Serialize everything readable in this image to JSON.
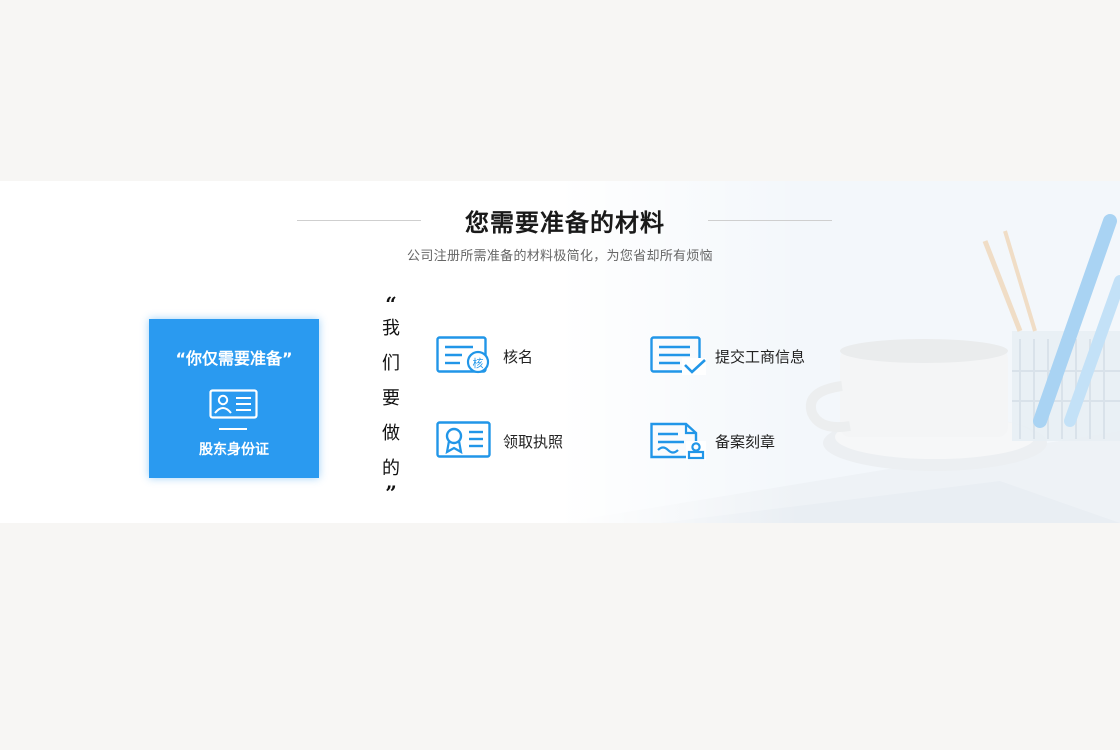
{
  "section": {
    "title": "您需要准备的材料",
    "subtitle": "公司注册所需准备的材料极简化，为您省却所有烦恼"
  },
  "card": {
    "title": "“你仅需要准备”",
    "label": "股东身份证",
    "icon": "id-card-icon"
  },
  "vertical_heading": {
    "open_quote": "“",
    "chars": [
      "我",
      "们",
      "要",
      "做",
      "的"
    ],
    "close_quote": "”"
  },
  "services": [
    {
      "label": "核名",
      "icon": "name-check-icon",
      "badge": "核"
    },
    {
      "label": "提交工商信息",
      "icon": "submit-document-icon"
    },
    {
      "label": "领取执照",
      "icon": "license-certificate-icon"
    },
    {
      "label": "备案刻章",
      "icon": "seal-record-icon"
    }
  ],
  "colors": {
    "accent": "#2a9af0",
    "icon_blue": "#2196e8",
    "title": "#1a1a1a",
    "subtitle": "#666666"
  }
}
